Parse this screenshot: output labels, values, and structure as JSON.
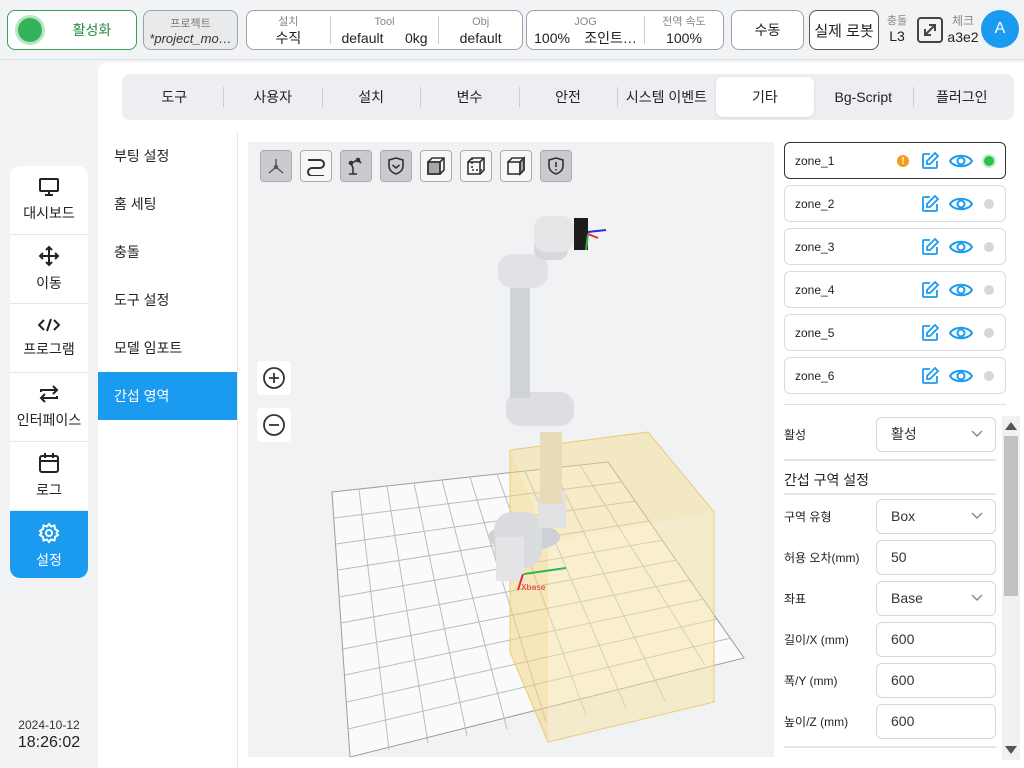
{
  "topbar": {
    "activate_label": "활성화",
    "project": {
      "caption": "프로젝트",
      "name": "*project_mo…"
    },
    "install": {
      "caption": "설치",
      "value": "수직"
    },
    "tool": {
      "caption": "Tool",
      "name": "default",
      "weight": "0kg"
    },
    "obj": {
      "caption": "Obj",
      "value": "default"
    },
    "jog": {
      "caption": "JOG",
      "value": "100%",
      "mode": "조인트…"
    },
    "speed": {
      "caption": "전역 속도",
      "value": "100%"
    },
    "manual_label": "수동",
    "real_robot_label": "실제 로봇",
    "collision": {
      "caption": "충돌",
      "value": "L3"
    },
    "check": {
      "caption": "체크",
      "value": "a3e2"
    },
    "avatar": "A"
  },
  "nav": {
    "items": [
      {
        "label": "대시보드",
        "icon": "monitor-icon"
      },
      {
        "label": "이동",
        "icon": "move-icon"
      },
      {
        "label": "프로그램",
        "icon": "code-icon"
      },
      {
        "label": "인터페이스",
        "icon": "swap-icon"
      },
      {
        "label": "로그",
        "icon": "calendar-icon"
      },
      {
        "label": "설정",
        "icon": "gear-icon"
      }
    ],
    "active": "설정"
  },
  "clock": {
    "date": "2024-10-12",
    "time": "18:26:02"
  },
  "tabs": [
    "도구",
    "사용자",
    "설치",
    "변수",
    "안전",
    "시스템 이벤트",
    "기타",
    "Bg-Script",
    "플러그인"
  ],
  "active_tab": "기타",
  "submenu": [
    "부팅 설정",
    "홈 세팅",
    "충돌",
    "도구 설정",
    "모델 임포트",
    "간섭 영역"
  ],
  "active_sub": "간섭 영역",
  "viewport": {
    "tools": [
      "view-axis-icon",
      "path-icon",
      "robot-icon",
      "shield-icon",
      "cube-front-icon",
      "cube-iso-icon",
      "cube-side-icon",
      "shield-alert-icon"
    ],
    "axis_label": "Xbase"
  },
  "zones": [
    {
      "name": "zone_1",
      "warning": true,
      "active": true
    },
    {
      "name": "zone_2",
      "warning": false,
      "active": false
    },
    {
      "name": "zone_3",
      "warning": false,
      "active": false
    },
    {
      "name": "zone_4",
      "warning": false,
      "active": false
    },
    {
      "name": "zone_5",
      "warning": false,
      "active": false
    },
    {
      "name": "zone_6",
      "warning": false,
      "active": false
    }
  ],
  "form": {
    "active": {
      "label": "활성",
      "value": "활성"
    },
    "section_title": "간섭 구역 설정",
    "zone_type": {
      "label": "구역 유형",
      "value": "Box"
    },
    "tolerance": {
      "label": "허용 오차(mm)",
      "value": "50"
    },
    "coord": {
      "label": "좌표",
      "value": "Base"
    },
    "length": {
      "label": "길이/X (mm)",
      "value": "600"
    },
    "width": {
      "label": "폭/Y (mm)",
      "value": "600"
    },
    "height": {
      "label": "높이/Z (mm)",
      "value": "600"
    }
  },
  "colors": {
    "accent": "#1a9bf0",
    "active_green": "#35b25a",
    "warning": "#f59a1b",
    "zone_fill": "#f5dc8a"
  }
}
